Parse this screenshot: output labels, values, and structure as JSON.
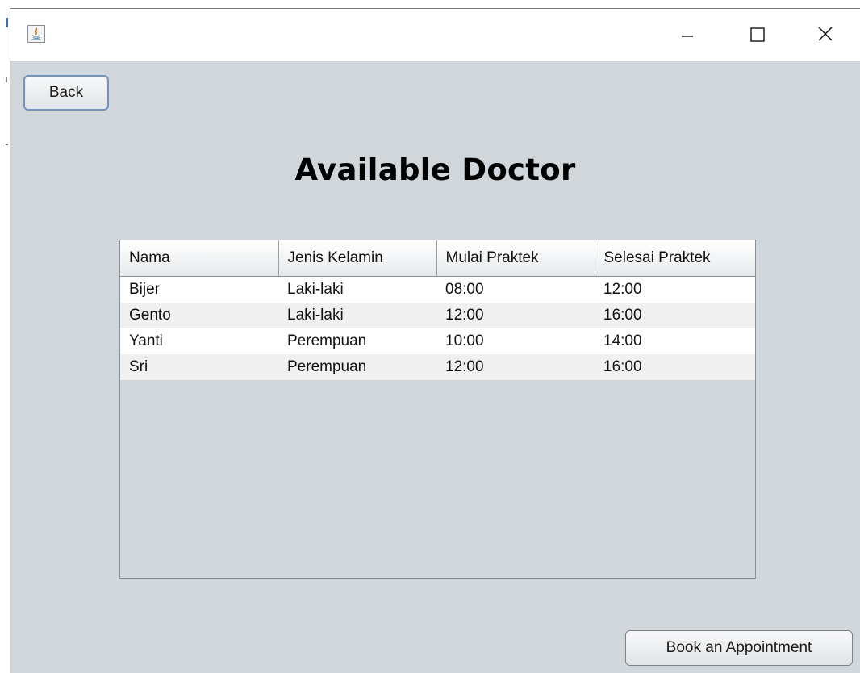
{
  "window": {
    "title": "",
    "controls": {
      "minimize": "minimize-icon",
      "maximize": "maximize-icon",
      "close": "close-icon"
    }
  },
  "back_button": {
    "label": "Back"
  },
  "page_title": "Available Doctor",
  "table": {
    "columns": [
      "Nama",
      "Jenis Kelamin",
      "Mulai Praktek",
      "Selesai Praktek"
    ],
    "rows": [
      [
        "Bijer",
        "Laki-laki",
        "08:00",
        "12:00"
      ],
      [
        "Gento",
        "Laki-laki",
        "12:00",
        "16:00"
      ],
      [
        "Yanti",
        "Perempuan",
        "10:00",
        "14:00"
      ],
      [
        "Sri",
        "Perempuan",
        "12:00",
        "16:00"
      ]
    ]
  },
  "book_button": {
    "label": "Book an Appointment"
  },
  "colors": {
    "content_background": "#d1d6da",
    "focus_border": "#7592b8",
    "row_odd": "#ffffff",
    "row_even": "#f0f0f0"
  }
}
